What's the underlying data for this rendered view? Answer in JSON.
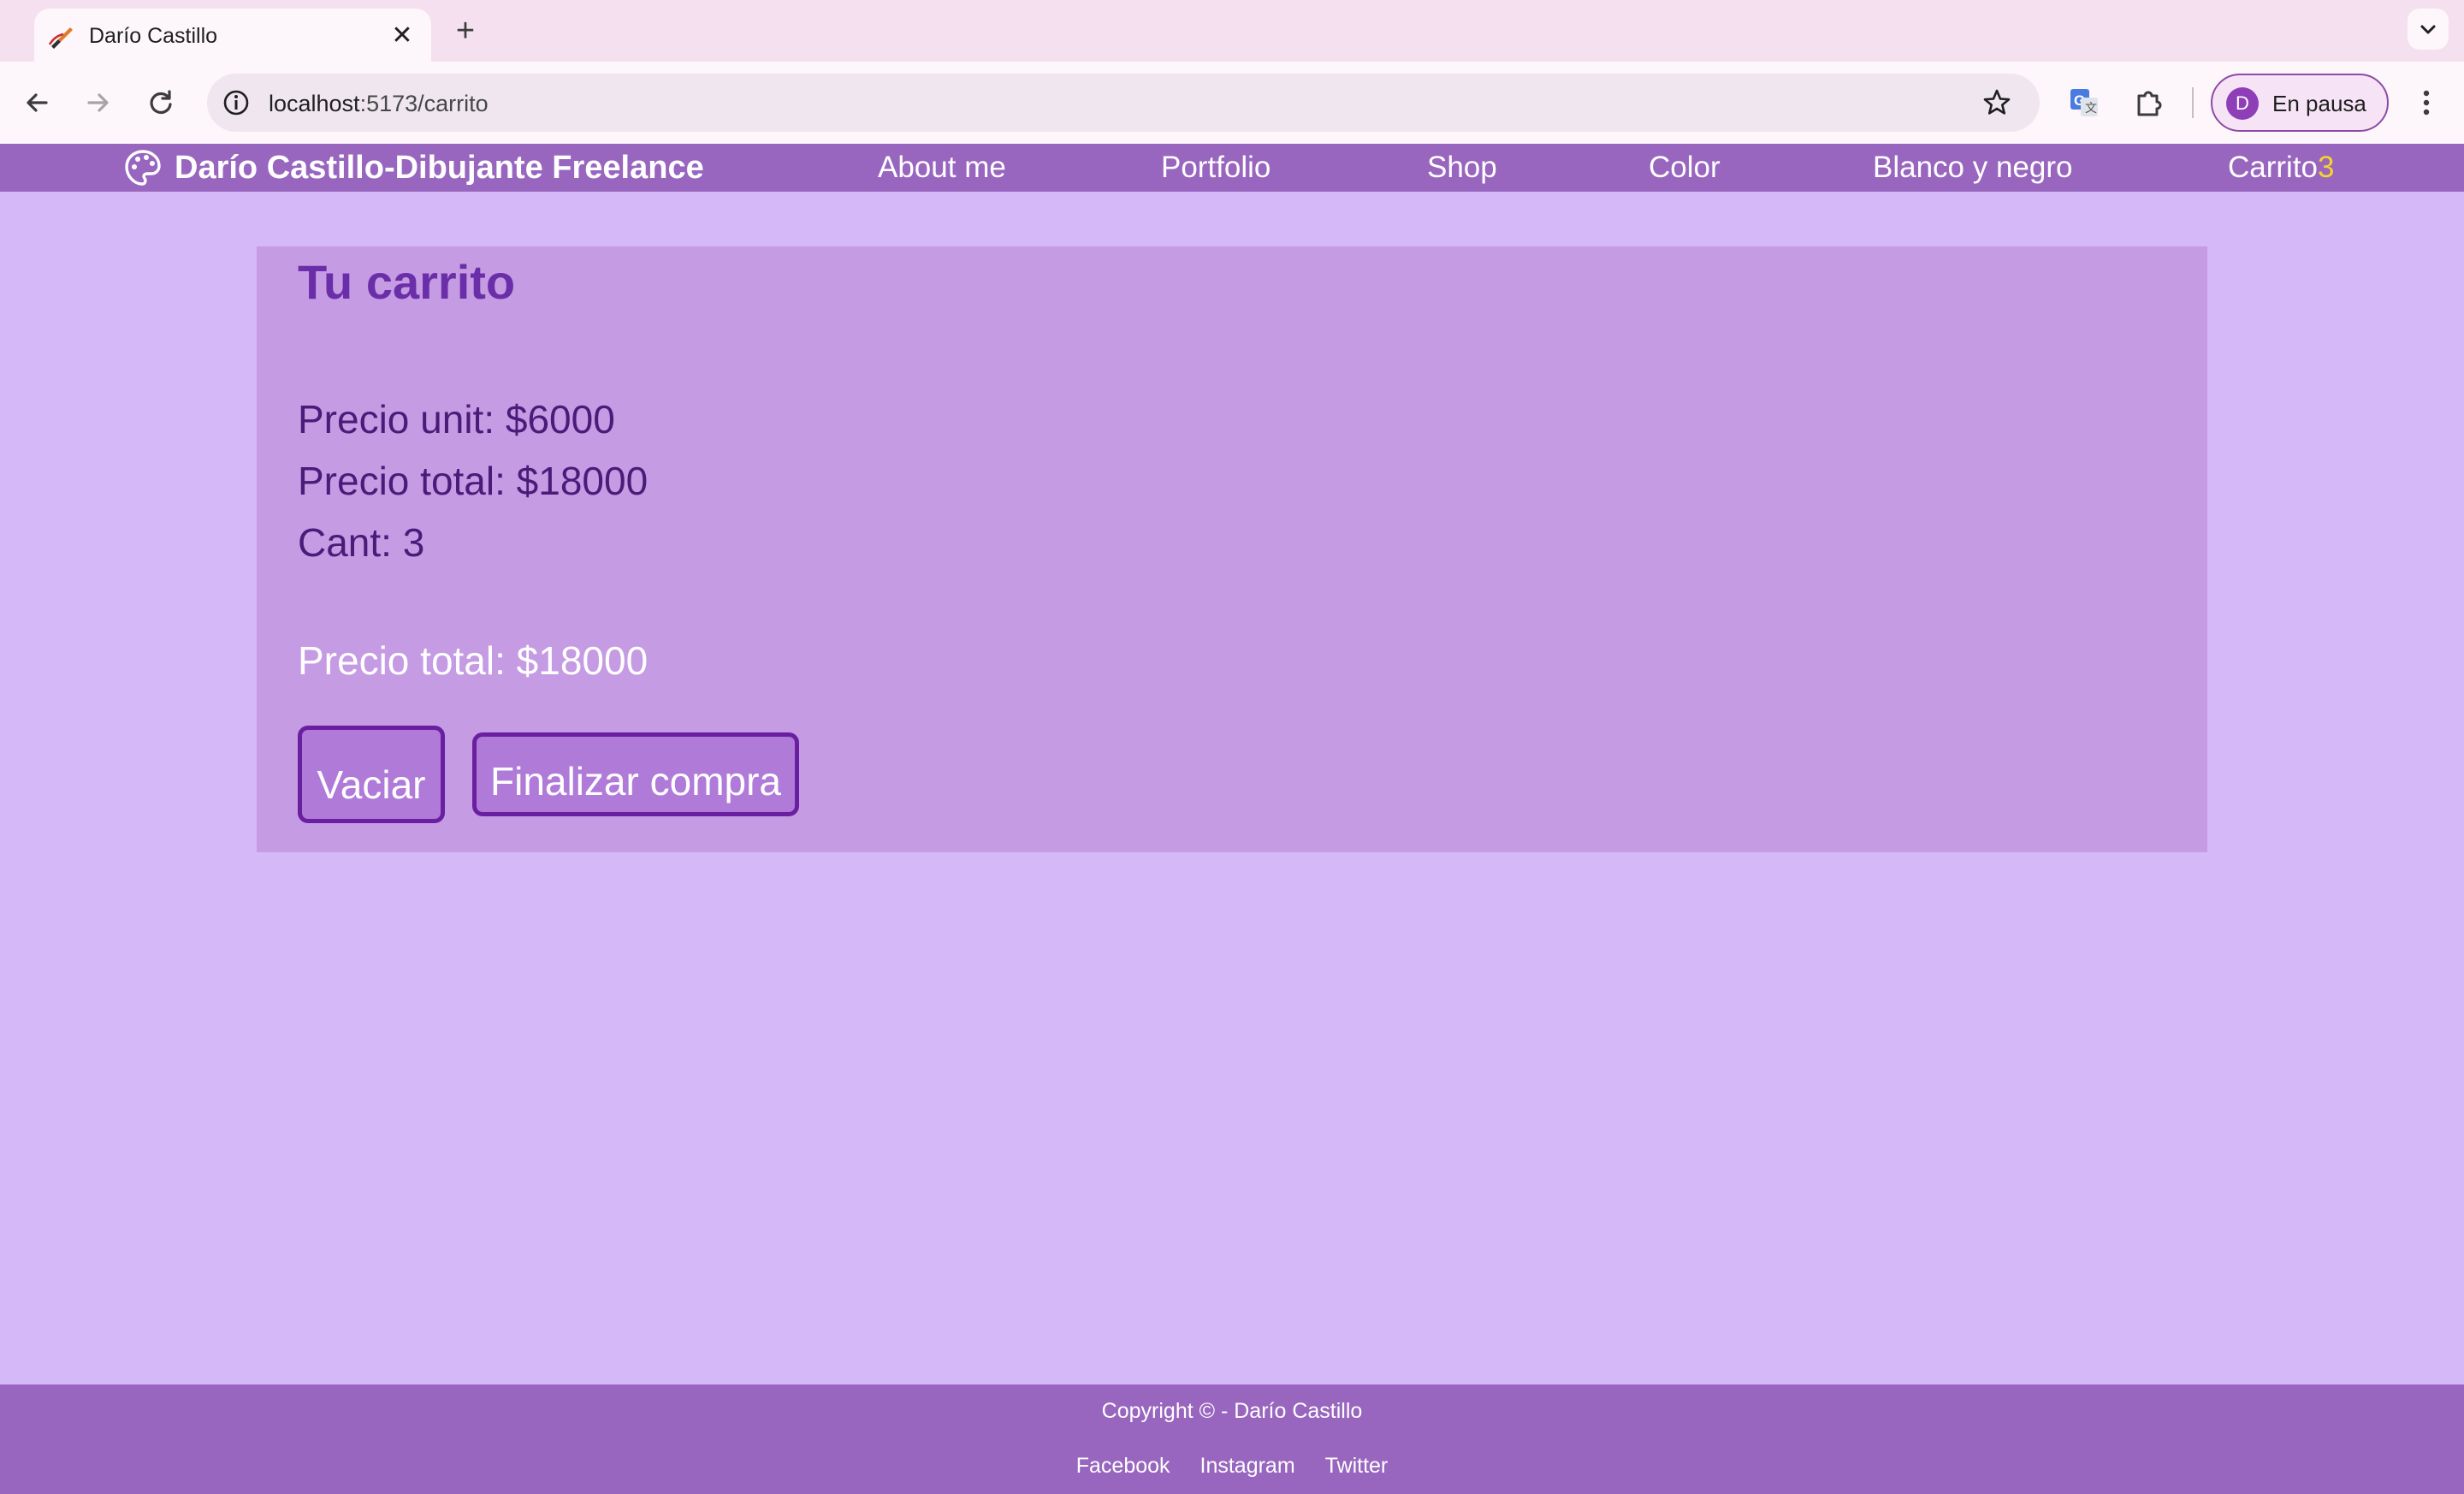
{
  "browser": {
    "tab": {
      "title": "Darío Castillo",
      "favicon": "paintbrush-icon",
      "close_glyph": "✕"
    },
    "new_tab_glyph": "+",
    "url": {
      "host": "localhost",
      "path": ":5173/carrito"
    },
    "profile": {
      "initial": "D",
      "label": "En pausa"
    }
  },
  "site": {
    "brand": "Darío Castillo-Dibujante Freelance",
    "brand_icon": "palette-icon",
    "nav": {
      "about": "About me",
      "portfolio": "Portfolio",
      "shop": "Shop",
      "color": "Color",
      "bw": "Blanco y negro",
      "cart_label": "Carrito",
      "cart_count": "3"
    }
  },
  "cart": {
    "title": "Tu carrito",
    "item": {
      "unit_price": "Precio unit: $6000",
      "total_price": "Precio total: $18000",
      "quantity": "Cant: 3"
    },
    "grand_total": "Precio total: $18000",
    "empty_button": "Vaciar",
    "checkout_button": "Finalizar compra"
  },
  "footer": {
    "copyright": "Copyright © - Darío Castillo",
    "links": [
      "Facebook",
      "Instagram",
      "Twitter"
    ]
  },
  "colors": {
    "page_bg": "#d4b8f7",
    "nav_bg": "#9966bf",
    "panel_bg": "#c59be3",
    "button_border": "#6a1fa0",
    "cart_count": "#f5d32c"
  }
}
